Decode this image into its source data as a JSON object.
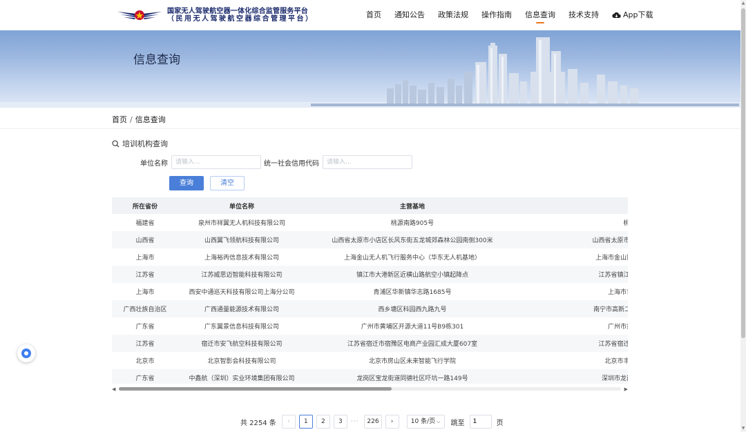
{
  "header": {
    "logo_line1": "国家无人驾驶航空器一体化综合监管服务平台",
    "logo_line2": "（民用无人驾驶航空器综合管理平台）",
    "nav": [
      "首页",
      "通知公告",
      "政策法规",
      "操作指南",
      "信息查询",
      "技术支持"
    ],
    "app_download": "App下载",
    "active_nav": "信息查询",
    "accent_color": "#e8741a"
  },
  "banner": {
    "title": "信息查询"
  },
  "breadcrumb": {
    "home": "首页",
    "sep": "/",
    "current": "信息查询"
  },
  "section": {
    "title": "培训机构查询",
    "icon": "search-icon"
  },
  "form": {
    "unit_name_label": "单位名称",
    "unit_name_placeholder": "请输入...",
    "credit_code_label": "统一社会信用代码",
    "credit_code_placeholder": "请输入...",
    "query_label": "查询",
    "clear_label": "清空",
    "primary_color": "#4a7fd9"
  },
  "table": {
    "headers": [
      "所在省份",
      "单位名称",
      "主营基地",
      ""
    ],
    "rows": [
      [
        "福建省",
        "泉州市祥翼无人机科技有限公司",
        "桃源南路905号",
        "桃"
      ],
      [
        "山西省",
        "山西翼飞领航科技有限公司",
        "山西省太原市小店区长风东街五龙城郊森林公园南侧300米",
        "山西省太原市小店区长风"
      ],
      [
        "上海市",
        "上海裕丙信息技术有限公司",
        "上海金山无人机飞行服务中心（华东无人机基地）",
        "上海市金山区亭卫公路"
      ],
      [
        "江苏省",
        "江苏威思迈智能科技有限公司",
        "镇江市大港新区近横山路航空小镇起降点",
        "江苏省镇江市京口区"
      ],
      [
        "上海市",
        "西安中通巡天科技有限公司上海分公司",
        "青浦区华新镇华志路1685号",
        "上海市青浦区"
      ],
      [
        "广西壮族自治区",
        "广西通量能源技术有限公司",
        "西乡塘区科园西九路九号",
        "南宁市高新二路1号广西"
      ],
      [
        "广东省",
        "广东翼景信息科技有限公司",
        "广州市黄埔区开源大道11号B9栋301",
        "广州市黄埔区"
      ],
      [
        "江苏省",
        "宿迁市安飞航空科技有限公司",
        "江苏省宿迁市宿豫区电商产业园汇成大厦607室",
        "江苏省宿迁市宿豫区"
      ],
      [
        "北京市",
        "北京智影会科技有限公司",
        "北京市房山区未来智能飞行学院",
        "北京市丰台区汉"
      ],
      [
        "广东省",
        "中鑫航（深圳）实业环境集团有限公司",
        "龙岗区宝龙街道同德社区吓坑一路149号",
        "深圳市龙岗区白灰"
      ]
    ]
  },
  "pagination": {
    "total_text": "共 2254 条",
    "prev": "‹",
    "pages": [
      "1",
      "2",
      "3"
    ],
    "ellipsis": "···",
    "last_page": "226",
    "next": "›",
    "page_size": "10 条/页",
    "jump_label": "跳至",
    "jump_value": "1",
    "page_unit": "页"
  }
}
